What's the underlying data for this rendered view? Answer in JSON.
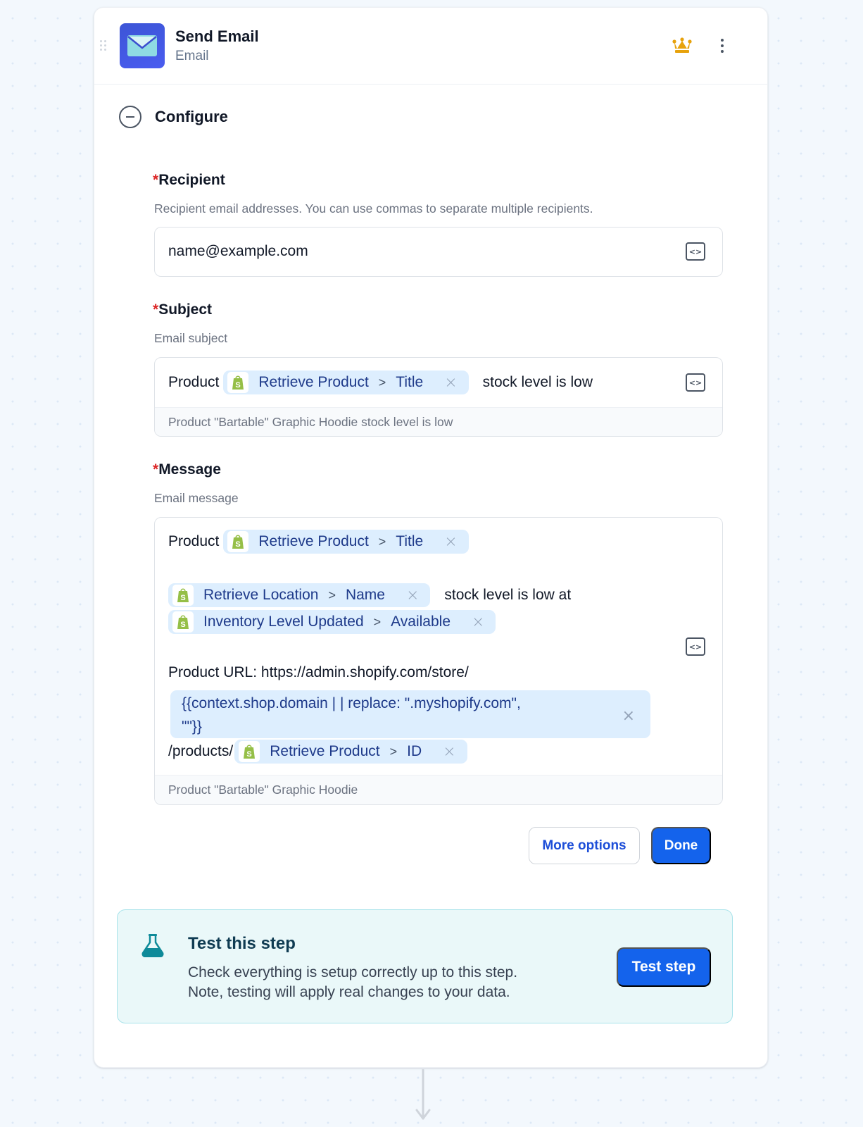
{
  "header": {
    "title": "Send Email",
    "subtitle": "Email",
    "app_icon": "envelope-icon",
    "premium_icon": "crown-icon",
    "menu_icon": "kebab-menu-icon",
    "brand_color": "#4154e6",
    "premium_color": "#e7a20c"
  },
  "section": {
    "label": "Configure",
    "toggle_icon": "collapse-minus-icon"
  },
  "fields": {
    "recipient": {
      "required_mark": "*",
      "label": "Recipient",
      "help": "Recipient email addresses. You can use commas to separate multiple recipients.",
      "value": "name@example.com"
    },
    "subject": {
      "required_mark": "*",
      "label": "Subject",
      "help": "Email subject",
      "prefix": "Product",
      "chip": {
        "source": "Retrieve Product",
        "field": "Title"
      },
      "suffix": "stock level is low",
      "preview": "Product \"Bartable\" Graphic Hoodie stock level is low"
    },
    "message": {
      "required_mark": "*",
      "label": "Message",
      "help": "Email message",
      "line1_prefix": "Product",
      "chip1": {
        "source": "Retrieve Product",
        "field": "Title"
      },
      "chip2": {
        "source": "Retrieve Location",
        "field": "Name"
      },
      "line2_text": "stock level is low at",
      "chip3": {
        "source": "Inventory Level Updated",
        "field": "Available"
      },
      "url_text": "Product URL: https://admin.shopify.com/store/",
      "liquid_line1": "{{context.shop.domain | | replace: \".myshopify.com\",",
      "liquid_line2": "\"\"}}",
      "products_text": "/products/",
      "chip4": {
        "source": "Retrieve Product",
        "field": "ID"
      },
      "preview": "Product \"Bartable\" Graphic Hoodie"
    }
  },
  "chip_separator": ">",
  "chip_close": "×",
  "code_toggle": "<>",
  "actions": {
    "more_options": "More options",
    "done": "Done"
  },
  "test_panel": {
    "title": "Test this step",
    "line1": "Check everything is setup correctly up to this step.",
    "line2": "Note, testing will apply real changes to your data.",
    "button": "Test step",
    "icon": "flask-icon"
  },
  "colors": {
    "primary": "#1463ec",
    "chip_bg": "#ddeefe",
    "chip_text": "#1e3a8a",
    "required": "#dc2626",
    "test_bg": "#eaf8f9",
    "test_border": "#a8e3ea",
    "shopify_green": "#95bf47"
  }
}
